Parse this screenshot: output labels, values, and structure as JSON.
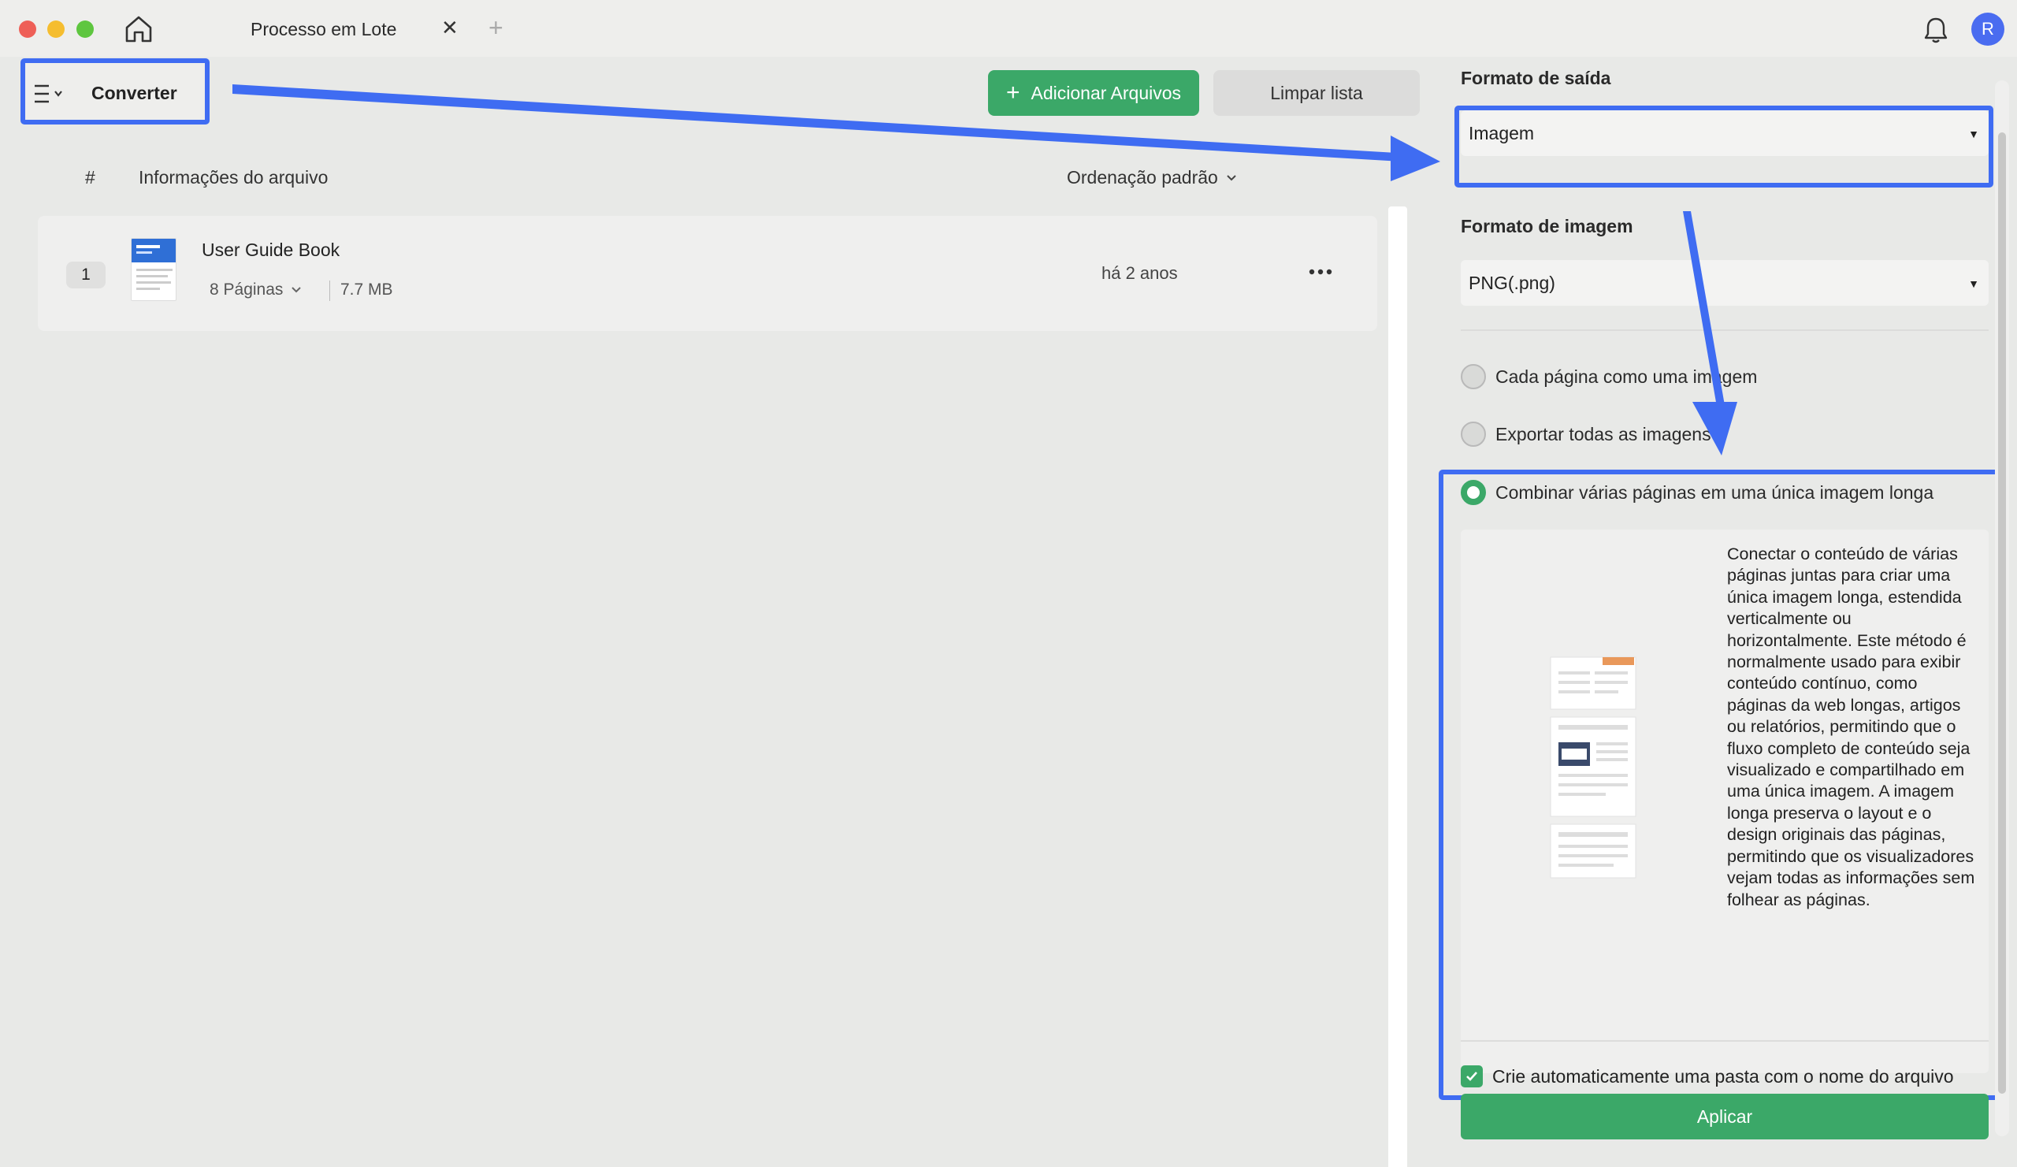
{
  "window": {
    "tab_title": "Processo em Lote",
    "tab_close": "✕",
    "tab_add": "+",
    "avatar_initial": "R"
  },
  "toolbar": {
    "converter_label": "Converter",
    "add_files_label": "Adicionar Arquivos",
    "add_files_plus": "+",
    "clear_list_label": "Limpar lista"
  },
  "list": {
    "header": {
      "hash": "#",
      "info": "Informações do arquivo",
      "sort": "Ordenação padrão"
    },
    "rows": [
      {
        "index": "1",
        "name": "User Guide Book",
        "pages": "8 Páginas",
        "size": "7.7 MB",
        "date": "há 2 anos"
      }
    ]
  },
  "settings": {
    "output_format_label": "Formato de saída",
    "output_format_value": "Imagem",
    "image_format_label": "Formato de imagem",
    "image_format_value": "PNG(.png)",
    "options": [
      {
        "label": "Cada página como uma imagem",
        "selected": false
      },
      {
        "label": "Exportar todas as imagens",
        "selected": false
      },
      {
        "label": "Combinar várias páginas em uma única imagem longa",
        "selected": true
      }
    ],
    "description": "Conectar o conteúdo de várias páginas juntas para criar uma única imagem longa, estendida verticalmente ou horizontalmente. Este método é normalmente usado para exibir conteúdo contínuo, como páginas da web longas, artigos ou relatórios, permitindo que o fluxo completo de conteúdo seja visualizado e compartilhado em uma única imagem. A imagem longa preserva o layout e o design originais das páginas, permitindo que os visualizadores vejam todas as informações sem folhear as páginas.",
    "auto_folder_label": "Crie automaticamente uma pasta com o nome do arquivo",
    "auto_folder_checked": true,
    "apply_label": "Aplicar"
  },
  "colors": {
    "accent_green": "#3ba868",
    "annotation_blue": "#3f6cf2"
  }
}
